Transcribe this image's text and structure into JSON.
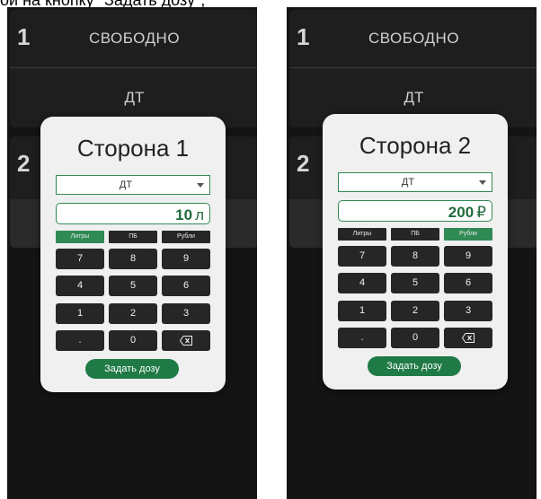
{
  "caption": "ой на кнопку \"Задать дозу\";",
  "screens": [
    {
      "nozzles": [
        {
          "number": "1",
          "status": "СВОБОДНО",
          "fuel": "ДТ"
        },
        {
          "number": "2"
        }
      ],
      "dialog": {
        "title": "Сторона 1",
        "fuel_select": "ДТ",
        "dose_value": "10",
        "dose_unit": "л",
        "modes": [
          "Литры",
          "ПБ",
          "Рубли"
        ],
        "active_mode": "Литры",
        "keys": [
          "7",
          "8",
          "9",
          "4",
          "5",
          "6",
          "1",
          "2",
          "3",
          ".",
          "0"
        ],
        "submit_label": "Задать дозу"
      }
    },
    {
      "nozzles": [
        {
          "number": "1",
          "status": "СВОБОДНО",
          "fuel": "ДТ"
        },
        {
          "number": "2"
        }
      ],
      "dialog": {
        "title": "Сторона 2",
        "fuel_select": "ДТ",
        "dose_value": "200",
        "dose_unit": "₽",
        "modes": [
          "Литры",
          "ПБ",
          "Рубли"
        ],
        "active_mode": "Рубли",
        "keys": [
          "7",
          "8",
          "9",
          "4",
          "5",
          "6",
          "1",
          "2",
          "3",
          ".",
          "0"
        ],
        "submit_label": "Задать дозу"
      }
    }
  ],
  "icons": {
    "backspace": "backspace-icon",
    "dropdown": "chevron-down-icon"
  },
  "colors": {
    "accent": "#2f8a54",
    "submit": "#1f7a45",
    "background": "#141414",
    "key": "#262626"
  }
}
